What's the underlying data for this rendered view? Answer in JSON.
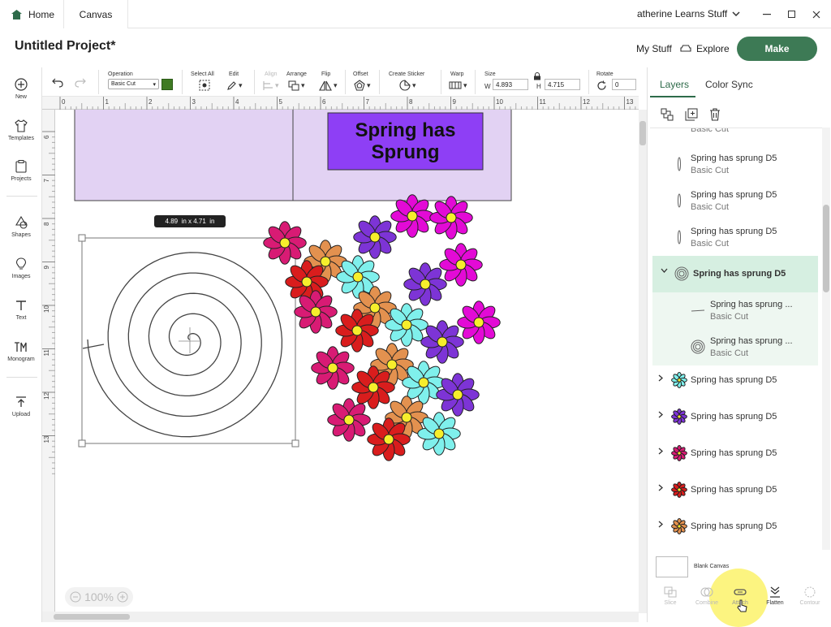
{
  "titlebar": {
    "home_tab": "Home",
    "canvas_tab": "Canvas",
    "user_name": "atherine Learns Stuff"
  },
  "header": {
    "project_title": "Untitled Project*",
    "my_stuff": "My Stuff",
    "explore": "Explore",
    "make": "Make"
  },
  "left_tools": [
    {
      "label": "New",
      "icon": "plus-circle-icon"
    },
    {
      "label": "Templates",
      "icon": "shirt-icon"
    },
    {
      "label": "Projects",
      "icon": "clipboard-icon"
    },
    {
      "label": "Shapes",
      "icon": "shapes-icon"
    },
    {
      "label": "Images",
      "icon": "lightbulb-icon"
    },
    {
      "label": "Text",
      "icon": "text-t-icon"
    },
    {
      "label": "Monogram",
      "icon": "monogram-icon"
    },
    {
      "label": "Upload",
      "icon": "upload-icon"
    }
  ],
  "toolbar": {
    "operation_label": "Operation",
    "operation_value": "Basic Cut",
    "operation_color": "#3f7a23",
    "select_all": "Select All",
    "edit": "Edit",
    "align": "Align",
    "arrange": "Arrange",
    "flip": "Flip",
    "offset": "Offset",
    "create_sticker": "Create Sticker",
    "warp": "Warp",
    "size": "Size",
    "w_label": "W",
    "w_value": "4.893",
    "h_label": "H",
    "h_value": "4.715",
    "rotate": "Rotate",
    "rotate_value": "0"
  },
  "rulers": {
    "top": [
      "0",
      "1",
      "2",
      "3",
      "4",
      "5",
      "6",
      "7",
      "8",
      "9",
      "10",
      "11",
      "12",
      "13"
    ],
    "left": [
      "6",
      "7",
      "8",
      "9",
      "10",
      "11",
      "12",
      "13"
    ]
  },
  "canvas": {
    "sign_text_line1": "Spring has",
    "sign_text_line2": "Sprung",
    "dimension_badge": "4.89  in x 4.71  in",
    "zoom": "100%",
    "sign_bg": "#e2d2f3",
    "sign_text_bg": "#8e3ff5"
  },
  "panel": {
    "layers_tab": "Layers",
    "color_sync_tab": "Color Sync",
    "blank_canvas": "Blank Canvas",
    "layers": [
      {
        "name": "",
        "sub": "Basic Cut"
      },
      {
        "name": "Spring has sprung D5",
        "sub": "Basic Cut"
      },
      {
        "name": "Spring has sprung D5",
        "sub": "Basic Cut"
      },
      {
        "name": "Spring has sprung D5",
        "sub": "Basic Cut"
      },
      {
        "name": "Spring has sprung D5",
        "sub": ""
      },
      {
        "name": "Spring has sprung ...",
        "sub": "Basic Cut"
      },
      {
        "name": "Spring has sprung ...",
        "sub": "Basic Cut"
      },
      {
        "name": "Spring has sprung D5",
        "sub": ""
      },
      {
        "name": "Spring has sprung D5",
        "sub": ""
      },
      {
        "name": "Spring has sprung D5",
        "sub": ""
      },
      {
        "name": "Spring has sprung D5",
        "sub": ""
      },
      {
        "name": "Spring has sprung D5",
        "sub": ""
      }
    ],
    "bottom_actions": [
      "Slice",
      "Combine",
      "Attach",
      "Flatten",
      "Contour"
    ]
  },
  "flower_colors": {
    "magenta": "#e30ad6",
    "pink": "#d81b74",
    "purple": "#7d34d6",
    "red": "#d91d1d",
    "orange": "#e3914f",
    "cyan": "#7ff0ec",
    "center": "#f6ee2c"
  }
}
